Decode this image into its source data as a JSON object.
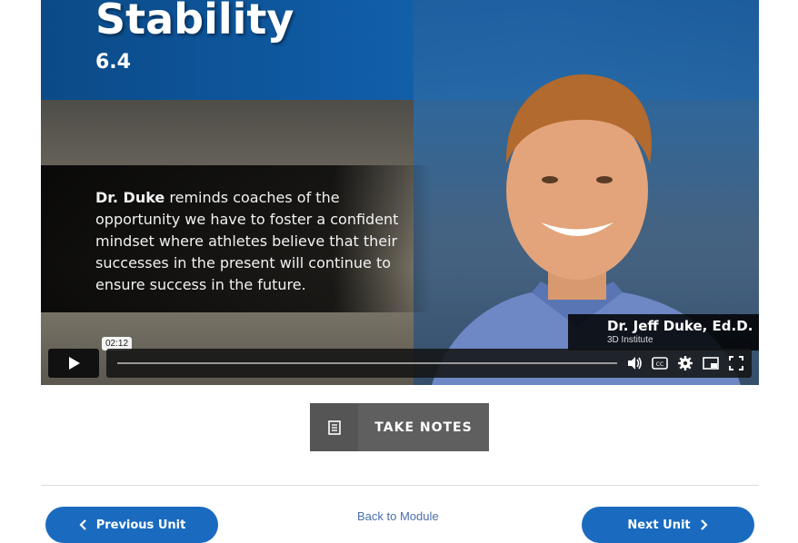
{
  "video": {
    "title": "Stability",
    "subtitle": "6.4",
    "quote_lead": "Dr. Duke",
    "quote_rest": " reminds coaches of the opportunity we have to foster a confident mindset where athletes believe that their successes in the present will continue to ensure success in the future.",
    "speaker_name": "Dr. Jeff Duke, Ed.D.",
    "speaker_org": "3D Institute",
    "time_tooltip": "02:12",
    "progress": 0.0
  },
  "controls": {
    "icons": [
      "play-icon",
      "volume-icon",
      "captions-icon",
      "settings-icon",
      "pip-icon",
      "fullscreen-icon"
    ]
  },
  "notes": {
    "label": "TAKE NOTES",
    "icon": "notes-icon"
  },
  "nav": {
    "prev_label": "Previous Unit",
    "back_label": "Back to Module",
    "next_label": "Next Unit"
  },
  "colors": {
    "accent": "#1a6bbf",
    "notes_bg": "#5f5f5f",
    "link": "#4a6fa8"
  }
}
